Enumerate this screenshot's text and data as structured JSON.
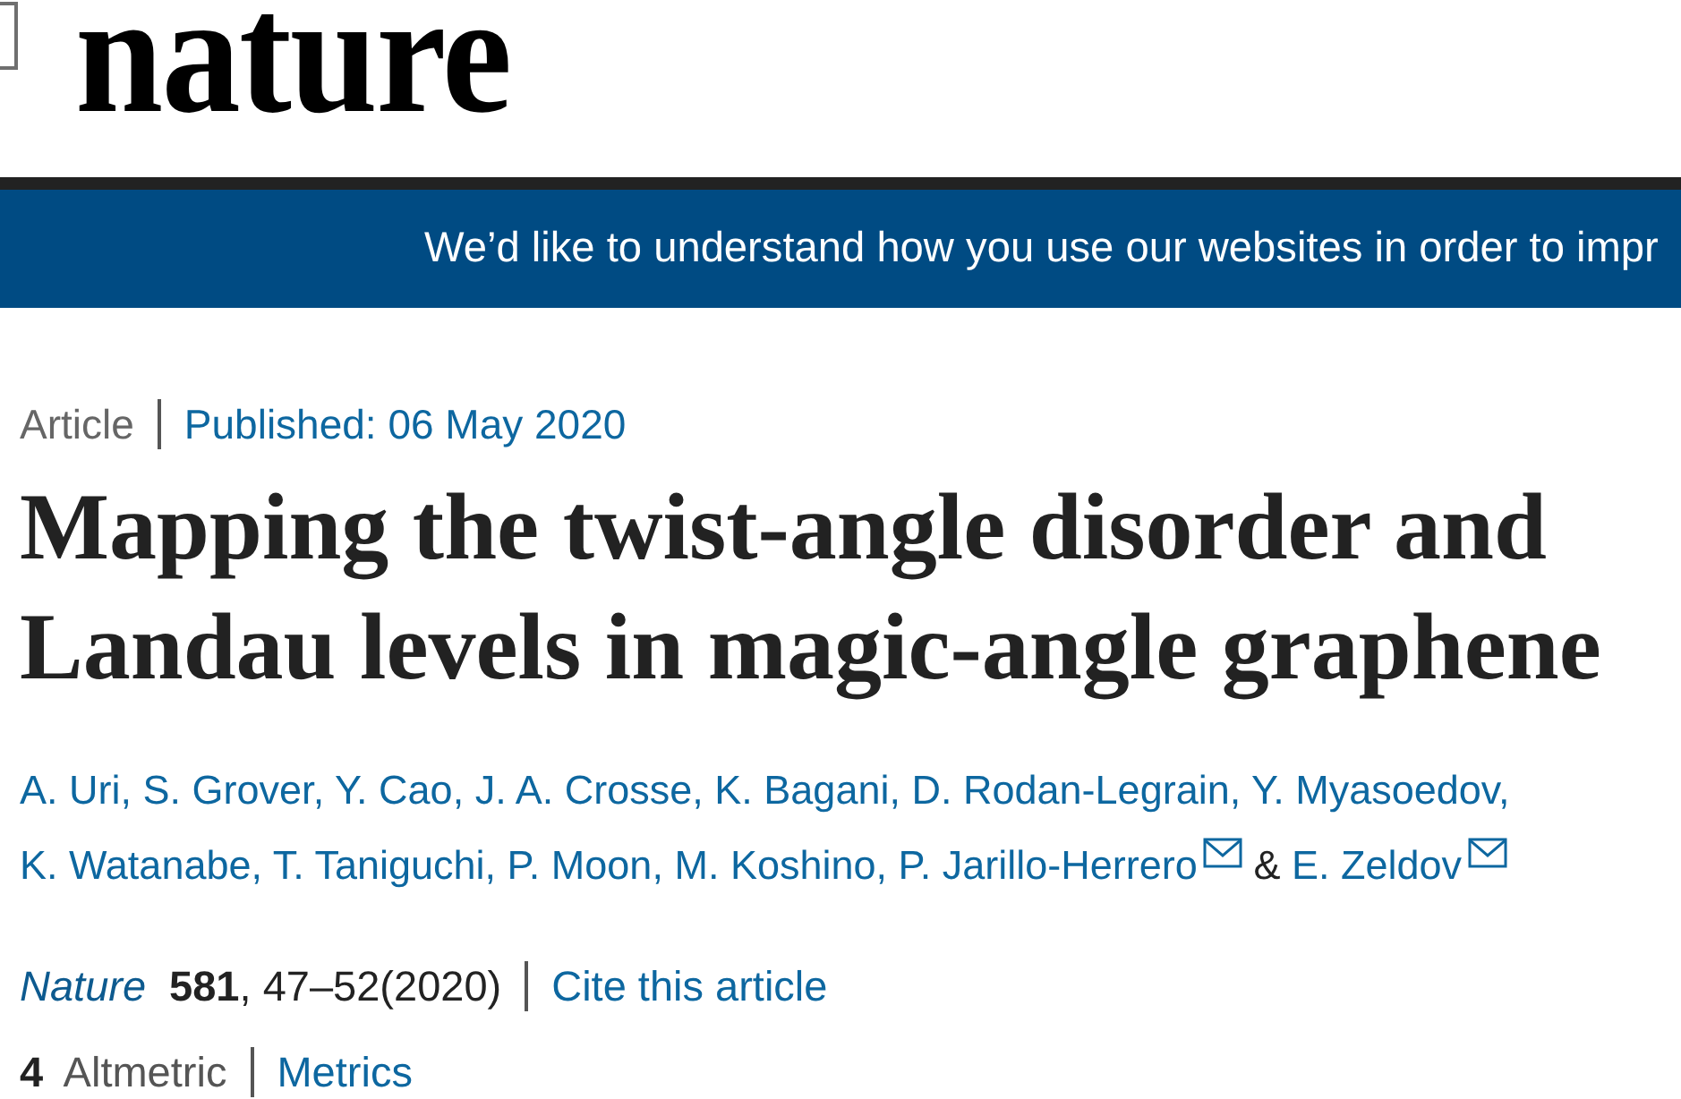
{
  "header": {
    "logo": "nature"
  },
  "cookie_banner": {
    "text": "We’d like to understand how you use our websites in order to impr"
  },
  "article": {
    "type": "Article",
    "published": "Published: 06 May 2020",
    "title": "Mapping the twist-angle disorder and Landau levels in magic-angle graphene",
    "authors": [
      {
        "kind": "author",
        "name": "A. Uri,",
        "email": false
      },
      {
        "kind": "author",
        "name": "S. Grover,",
        "email": false
      },
      {
        "kind": "author",
        "name": "Y. Cao,",
        "email": false
      },
      {
        "kind": "author",
        "name": "J. A. Crosse,",
        "email": false
      },
      {
        "kind": "author",
        "name": "K. Bagani,",
        "email": false
      },
      {
        "kind": "author",
        "name": "D. Rodan-Legrain,",
        "email": false
      },
      {
        "kind": "author",
        "name": "Y. Myasoedov,",
        "email": false
      },
      {
        "kind": "author",
        "name": "K. Watanabe,",
        "email": false
      },
      {
        "kind": "author",
        "name": "T. Taniguchi,",
        "email": false
      },
      {
        "kind": "author",
        "name": "P. Moon,",
        "email": false
      },
      {
        "kind": "author",
        "name": "M. Koshino,",
        "email": false
      },
      {
        "kind": "author",
        "name": "P. Jarillo-Herrero",
        "email": true
      },
      {
        "kind": "conjunction",
        "text": "&"
      },
      {
        "kind": "author",
        "name": "E. Zeldov",
        "email": true
      }
    ],
    "citation": {
      "journal": "Nature",
      "details": "**581**, 47–52(2020)",
      "cite_link": "Cite this article"
    },
    "metrics": {
      "altmetric": "**4** Altmetric",
      "link": "Metrics"
    }
  }
}
